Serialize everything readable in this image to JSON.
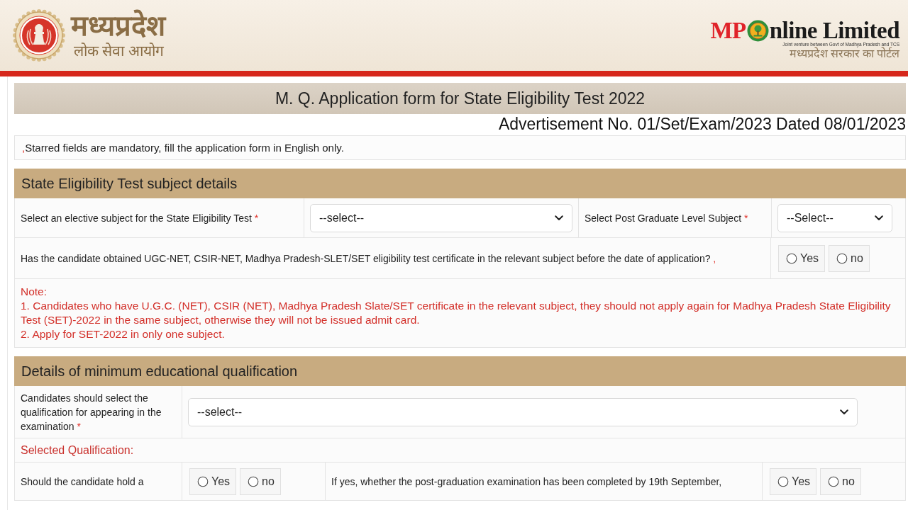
{
  "header": {
    "logo_title": "मध्यप्रदेश",
    "logo_subtitle": "लोक सेवा आयोग",
    "portal": {
      "brand_start": "MP",
      "brand_end": "nline Limited",
      "tagline": "Joint venture between Govt of Madhya Pradesh and TCS",
      "hindi_tagline": "मध्यप्रदेश सरकार का पोर्टल"
    }
  },
  "form": {
    "title": "M. Q. Application form for State Eligibility Test 2022",
    "advertisement": "Advertisement No. 01/Set/Exam/2023 Dated 08/01/2023",
    "notice": {
      "mark": ",",
      "text": "Starred fields are mandatory, fill the application form in English only."
    },
    "sections": [
      {
        "title": "State Eligibility Test subject details",
        "rows": [
          {
            "kind": "select_pair",
            "fields": [
              {
                "label": "Select an elective subject for the State Eligibility Test",
                "mark": "*",
                "value": "--select--"
              },
              {
                "label": "Select Post Graduate Level Subject",
                "mark": "*",
                "value": "--Select--"
              }
            ]
          },
          {
            "kind": "question",
            "text": "Has the candidate obtained UGC-NET, CSIR-NET, Madhya Pradesh-SLET/SET eligibility test certificate in the relevant subject before the date of application?",
            "mark": ",",
            "options": [
              {
                "label": "Yes",
                "selected": false
              },
              {
                "label": "no",
                "selected": false
              }
            ]
          },
          {
            "kind": "note",
            "heading": "Note:",
            "items": [
              "1. Candidates who have U.G.C. (NET), CSIR (NET), Madhya Pradesh Slate/SET certificate in the relevant subject, they should not apply again for Madhya Pradesh State Eligibility Test (SET)-2022 in the same subject, otherwise they will not be issued admit card.",
              "2. Apply for SET-2022 in only one subject."
            ]
          }
        ]
      },
      {
        "title": "Details of minimum educational qualification",
        "rows": [
          {
            "kind": "wide_select",
            "label": "Candidates should select the qualification for appearing in the examination",
            "mark": "*",
            "value": "--select--"
          },
          {
            "kind": "subheading",
            "text": "Selected Qualification:"
          },
          {
            "kind": "question_pair",
            "questions": [
              {
                "text": "Should the candidate hold a",
                "options": [
                  {
                    "label": "Yes",
                    "selected": false
                  },
                  {
                    "label": "no",
                    "selected": false
                  }
                ]
              },
              {
                "text": "If yes, whether the post-graduation examination has been completed by 19th September,",
                "options": [
                  {
                    "label": "Yes",
                    "selected": false
                  },
                  {
                    "label": "no",
                    "selected": false
                  }
                ]
              }
            ]
          }
        ]
      }
    ]
  }
}
